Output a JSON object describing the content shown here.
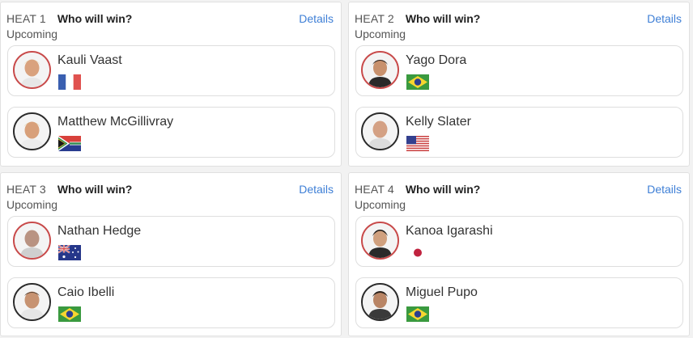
{
  "heats": [
    {
      "heat_label": "HEAT 1",
      "question": "Who will win?",
      "details_label": "Details",
      "status": "Upcoming",
      "surfers": [
        {
          "name": "Kauli Vaast",
          "flag": "france-flag-icon"
        },
        {
          "name": "Matthew McGillivray",
          "flag": "south-africa-flag-icon"
        }
      ]
    },
    {
      "heat_label": "HEAT 2",
      "question": "Who will win?",
      "details_label": "Details",
      "status": "Upcoming",
      "surfers": [
        {
          "name": "Yago Dora",
          "flag": "brazil-flag-icon"
        },
        {
          "name": "Kelly Slater",
          "flag": "usa-flag-icon"
        }
      ]
    },
    {
      "heat_label": "HEAT 3",
      "question": "Who will win?",
      "details_label": "Details",
      "status": "Upcoming",
      "surfers": [
        {
          "name": "Nathan Hedge",
          "flag": "australia-flag-icon"
        },
        {
          "name": "Caio Ibelli",
          "flag": "brazil-flag-icon"
        }
      ]
    },
    {
      "heat_label": "HEAT 4",
      "question": "Who will win?",
      "details_label": "Details",
      "status": "Upcoming",
      "surfers": [
        {
          "name": "Kanoa Igarashi",
          "flag": "japan-flag-icon"
        },
        {
          "name": "Miguel Pupo",
          "flag": "brazil-flag-icon"
        }
      ]
    }
  ],
  "colors": {
    "link": "#3e7fd6",
    "first_surfer_ring": "#c84a4a",
    "second_surfer_ring": "#2b2b2b"
  }
}
